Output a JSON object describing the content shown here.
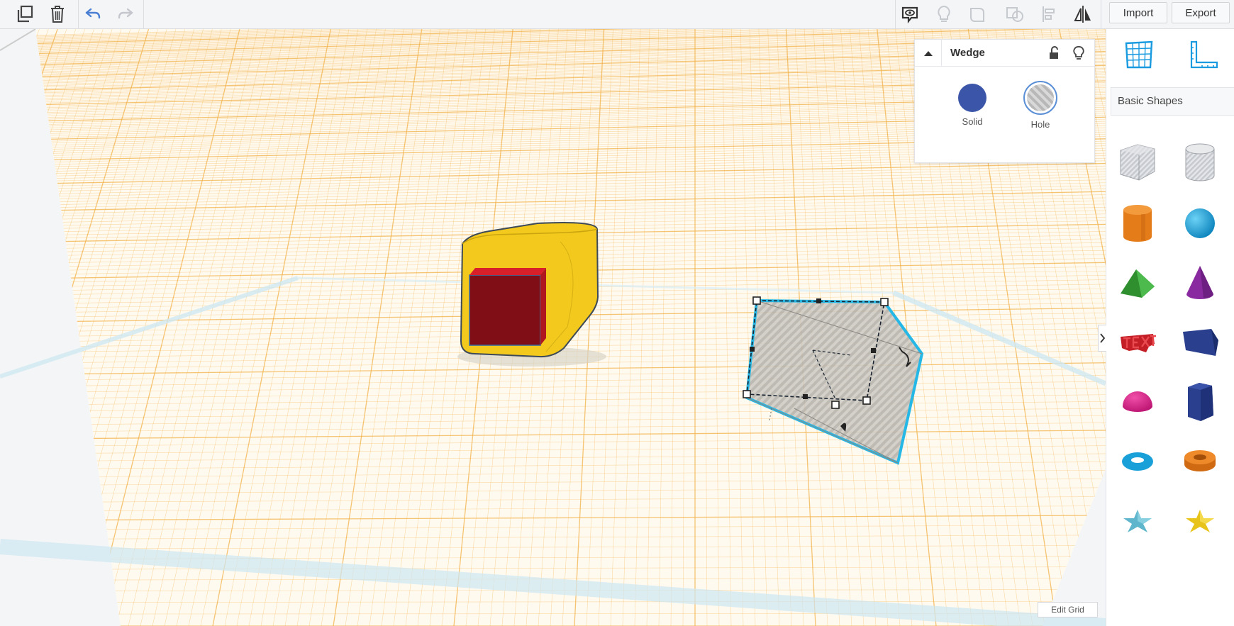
{
  "toolbar": {
    "import_label": "Import",
    "export_label": "Export",
    "icons": [
      "copy-icon",
      "trash-icon",
      "undo-icon",
      "redo-icon",
      "notes-icon",
      "lightbulb-icon",
      "group-icon",
      "ungroup-icon",
      "align-icon",
      "mirror-icon"
    ]
  },
  "inspector": {
    "shape_name": "Wedge",
    "solid_label": "Solid",
    "hole_label": "Hole",
    "solid_color": "#3b55a8"
  },
  "panel": {
    "category": "Basic Shapes",
    "shapes": [
      {
        "name": "box-hole",
        "color": "#c8cbd0"
      },
      {
        "name": "cylinder-hole",
        "color": "#c8cbd0"
      },
      {
        "name": "cylinder",
        "color": "#e8801c"
      },
      {
        "name": "sphere",
        "color": "#1aa0d8"
      },
      {
        "name": "roof",
        "color": "#3aa53a"
      },
      {
        "name": "cone",
        "color": "#8a2aa0"
      },
      {
        "name": "text",
        "color": "#d42a2a"
      },
      {
        "name": "wedge",
        "color": "#2a3f8e"
      },
      {
        "name": "half-sphere",
        "color": "#d91a86"
      },
      {
        "name": "polygon",
        "color": "#2a3f8e"
      },
      {
        "name": "torus",
        "color": "#1aa0d8"
      },
      {
        "name": "tube",
        "color": "#e8801c"
      },
      {
        "name": "star",
        "color": "#5fb6cc"
      },
      {
        "name": "star-gold",
        "color": "#e8c41a"
      }
    ]
  },
  "workplane": {
    "edit_grid_label": "Edit Grid",
    "grid_color": "#f2b24a",
    "box_color": "#f2c91c",
    "red_color": "#c01820"
  }
}
